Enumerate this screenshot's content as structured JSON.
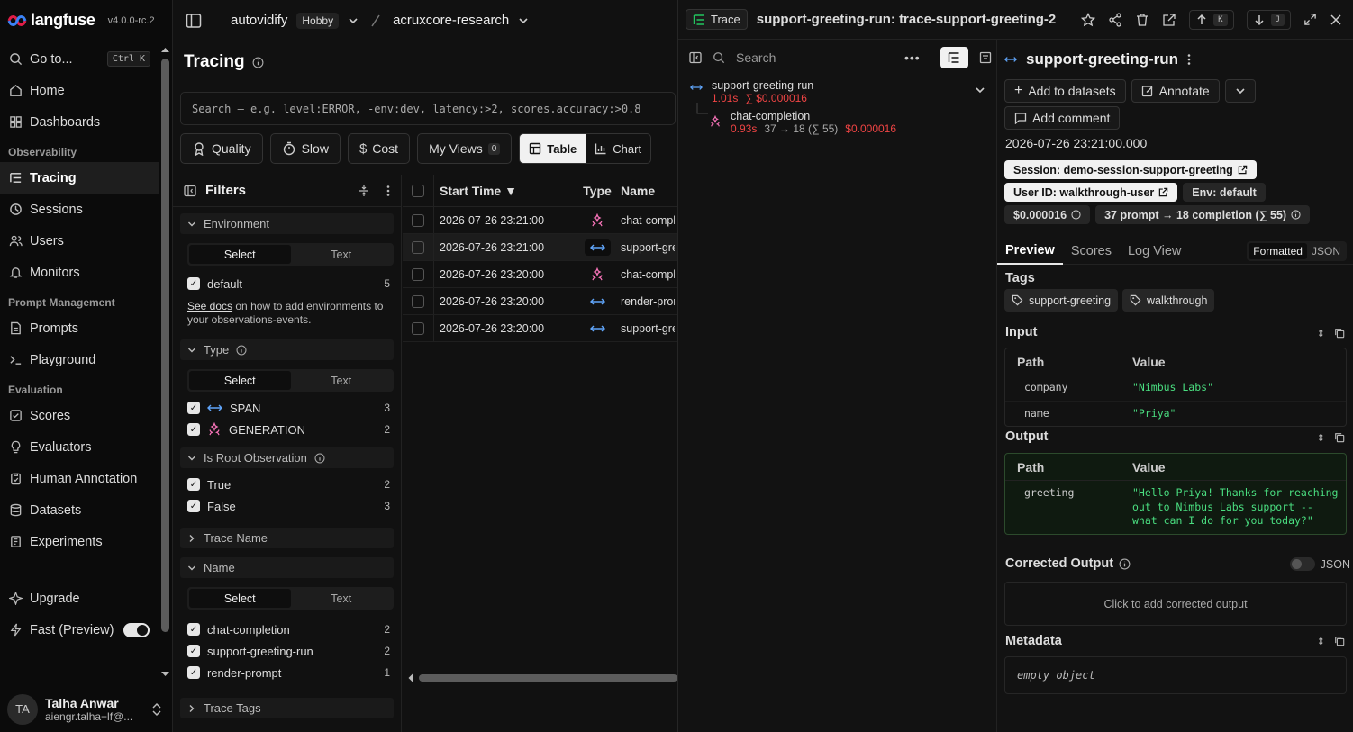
{
  "sidebar": {
    "brand": "langfuse",
    "version": "v4.0.0-rc.2",
    "goto": "Go to...",
    "goto_kbd": "Ctrl K",
    "items_top": [
      {
        "label": "Home",
        "icon": "home-icon"
      },
      {
        "label": "Dashboards",
        "icon": "dashboard-icon"
      }
    ],
    "sections": [
      {
        "title": "Observability",
        "items": [
          {
            "label": "Tracing",
            "icon": "list-tree-icon",
            "active": true
          },
          {
            "label": "Sessions",
            "icon": "clock-icon"
          },
          {
            "label": "Users",
            "icon": "users-icon"
          },
          {
            "label": "Monitors",
            "icon": "bell-icon"
          }
        ]
      },
      {
        "title": "Prompt Management",
        "items": [
          {
            "label": "Prompts",
            "icon": "file-text-icon"
          },
          {
            "label": "Playground",
            "icon": "terminal-icon"
          }
        ]
      },
      {
        "title": "Evaluation",
        "items": [
          {
            "label": "Scores",
            "icon": "check-square-icon"
          },
          {
            "label": "Evaluators",
            "icon": "lightbulb-icon"
          },
          {
            "label": "Human Annotation",
            "icon": "clipboard-icon"
          },
          {
            "label": "Datasets",
            "icon": "database-icon"
          },
          {
            "label": "Experiments",
            "icon": "flask-icon"
          }
        ]
      }
    ],
    "upgrade": "Upgrade",
    "fast_preview": "Fast (Preview)",
    "user": {
      "initials": "TA",
      "name": "Talha Anwar",
      "email": "aiengr.talha+lf@..."
    }
  },
  "topbar": {
    "org": "autovidify",
    "plan": "Hobby",
    "project": "acruxcore-research"
  },
  "tracing": {
    "title": "Tracing",
    "search_placeholder": "Search — e.g. level:ERROR, -env:dev, latency:>2, scores.accuracy:>0.8",
    "buttons": {
      "quality": "Quality",
      "slow": "Slow",
      "cost": "Cost",
      "my_views": "My Views",
      "my_views_count": "0",
      "table": "Table",
      "chart": "Chart"
    },
    "filters": {
      "title": "Filters",
      "environment": {
        "label": "Environment",
        "select": "Select",
        "text": "Text",
        "options": [
          {
            "label": "default",
            "count": "5"
          }
        ],
        "note_link": "See docs",
        "note_rest": " on how to add environments to your observations-events."
      },
      "type": {
        "label": "Type",
        "select": "Select",
        "text": "Text",
        "options": [
          {
            "label": "SPAN",
            "count": "3"
          },
          {
            "label": "GENERATION",
            "count": "2"
          }
        ]
      },
      "is_root": {
        "label": "Is Root Observation",
        "options": [
          {
            "label": "True",
            "count": "2"
          },
          {
            "label": "False",
            "count": "3"
          }
        ]
      },
      "trace_name": {
        "label": "Trace Name"
      },
      "name": {
        "label": "Name",
        "select": "Select",
        "text": "Text",
        "options": [
          {
            "label": "chat-completion",
            "count": "2"
          },
          {
            "label": "support-greeting-run",
            "count": "2"
          },
          {
            "label": "render-prompt",
            "count": "1"
          }
        ]
      },
      "trace_tags": {
        "label": "Trace Tags"
      }
    },
    "table": {
      "headers": {
        "start_time": "Start Time",
        "type": "Type",
        "name": "Name"
      },
      "rows": [
        {
          "time": "2026-07-26 23:21:00",
          "type": "generation",
          "name": "chat-completion"
        },
        {
          "time": "2026-07-26 23:21:00",
          "type": "span",
          "name": "support-greeting-run"
        },
        {
          "time": "2026-07-26 23:20:00",
          "type": "generation",
          "name": "chat-completion"
        },
        {
          "time": "2026-07-26 23:20:00",
          "type": "span",
          "name": "render-prompt"
        },
        {
          "time": "2026-07-26 23:20:00",
          "type": "span",
          "name": "support-greeting-run"
        }
      ]
    }
  },
  "trace": {
    "tag": "Trace",
    "title": "support-greeting-run: trace-support-greeting-2",
    "kbd_up": "K",
    "kbd_down": "J",
    "tree": {
      "search_placeholder": "Search",
      "root": {
        "name": "support-greeting-run",
        "latency": "1.01s",
        "cost": "∑ $0.000016"
      },
      "child": {
        "name": "chat-completion",
        "latency": "0.93s",
        "tokens": "37 → 18 (∑ 55)",
        "cost": "$0.000016"
      }
    },
    "detail": {
      "name": "support-greeting-run",
      "add_to_datasets": "Add to datasets",
      "annotate": "Annotate",
      "add_comment": "Add comment",
      "timestamp": "2026-07-26 23:21:00.000",
      "session": "Session: demo-session-support-greeting",
      "user_id": "User ID: walkthrough-user",
      "env": "Env: default",
      "cost": "$0.000016",
      "tokens": "37 prompt → 18 completion (∑ 55)",
      "tabs": [
        "Preview",
        "Scores",
        "Log View"
      ],
      "fmt_formatted": "Formatted",
      "fmt_json": "JSON",
      "tags_title": "Tags",
      "tags": [
        "support-greeting",
        "walkthrough"
      ],
      "input_title": "Input",
      "path_header": "Path",
      "value_header": "Value",
      "input_rows": [
        {
          "path": "company",
          "value": "\"Nimbus Labs\""
        },
        {
          "path": "name",
          "value": "\"Priya\""
        }
      ],
      "output_title": "Output",
      "output_rows": [
        {
          "path": "greeting",
          "value": "\"Hello Priya! Thanks for reaching out to Nimbus Labs support -- what can I do for you today?\""
        }
      ],
      "corrected_title": "Corrected Output",
      "corrected_json": "JSON",
      "corrected_placeholder": "Click to add corrected output",
      "metadata_title": "Metadata",
      "metadata_value": "empty object"
    }
  },
  "colors": {
    "accent_red": "#ef4444",
    "value_green": "#4ade80",
    "span_blue": "#60a5fa",
    "generation_pink": "#f472b6"
  }
}
